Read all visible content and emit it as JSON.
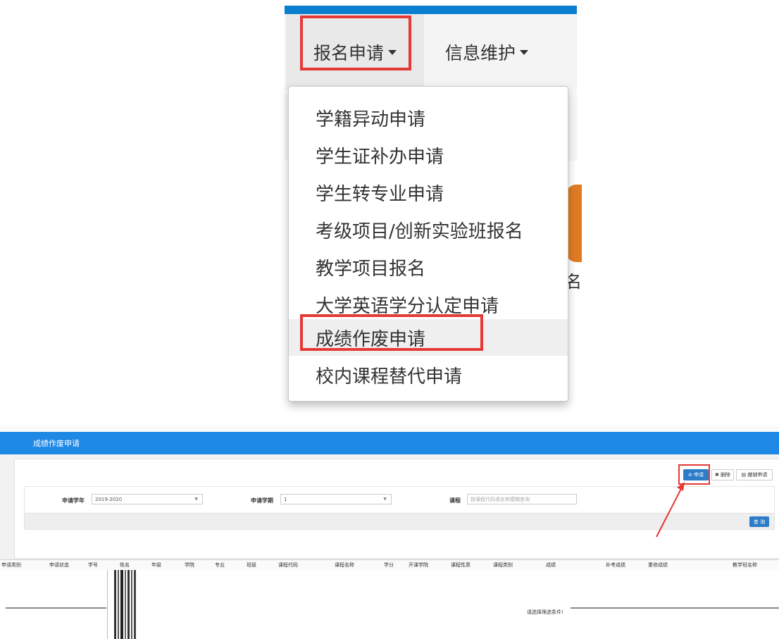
{
  "nav": {
    "apply_label": "报名申请",
    "info_label": "信息维护"
  },
  "dropdown_items": [
    "学籍异动申请",
    "学生证补办申请",
    "学生转专业申请",
    "考级项目/创新实验班报名",
    "教学项目报名",
    "大学英语学分认定申请",
    "成绩作废申请",
    "校内课程替代申请"
  ],
  "page": {
    "title": "成绩作废申请"
  },
  "toolbar": {
    "apply": "⊘ 申请",
    "delete": "✖ 删除",
    "revoke": "▤ 撤销申请"
  },
  "form": {
    "year_label": "申请学年",
    "year_value": "2019-2020",
    "term_label": "申请学期",
    "term_value": "1",
    "course_label": "课程",
    "course_placeholder": "按课程代码或名称模糊查询",
    "query_button": "查 询"
  },
  "grid": {
    "columns": [
      "申请类别",
      "申请状态",
      "学号",
      "姓名",
      "年级",
      "学院",
      "专业",
      "班级",
      "课程代码",
      "课程名称",
      "学分",
      "开课学院",
      "课程性质",
      "课程类别",
      "成绩",
      "补考成绩",
      "重修成绩",
      "教学班名称"
    ],
    "empty_message": "请选择筛选条件!"
  },
  "colors": {
    "brand_blue": "#1e88e5",
    "highlight_red": "#e53935"
  }
}
